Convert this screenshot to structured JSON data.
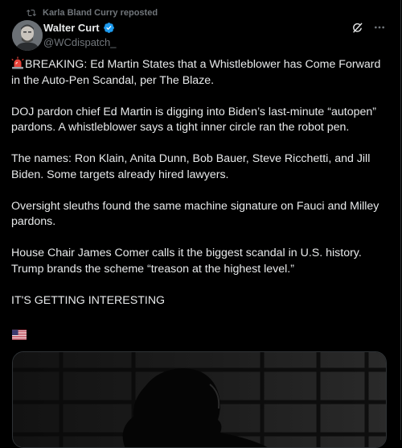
{
  "repost": {
    "icon": "repost-icon",
    "text": "Karla Bland Curry reposted"
  },
  "author": {
    "display_name": "Walter Curt",
    "handle": "@WCdispatch_",
    "verified": true,
    "verified_color": "#1d9bf0",
    "avatar_icon": "avatar"
  },
  "actions": {
    "grok_icon": "grok-icon",
    "more_icon": "more-icon"
  },
  "post": {
    "paragraphs": [
      "BREAKING: Ed Martin States that a Whistleblower has Come Forward in the Auto-Pen Scandal, per The Blaze.",
      "DOJ pardon chief Ed Martin is digging into Biden’s last-minute “autopen” pardons. A whistleblower says a tight inner circle ran the robot pen.",
      "The names: Ron Klain, Anita Dunn, Bob Bauer, Steve Ricchetti, and Jill Biden. Some targets already hired lawyers.",
      "Oversight sleuths found the same machine signature on Fauci and Milley pardons.",
      "House Chair James Comer calls it the biggest scandal in U.S. history. Trump brands the scheme “treason at the highest level.”",
      "IT'S GETTING INTERESTING"
    ],
    "leading_icon": "rotating-light-icon",
    "trailing_icon": "us-flag-icon"
  },
  "media": {
    "type": "image",
    "description_icon": "silhouette-photo"
  },
  "colors": {
    "background": "#000000",
    "text": "#e7e9ea",
    "muted": "#71767b",
    "border": "#2f3336"
  }
}
